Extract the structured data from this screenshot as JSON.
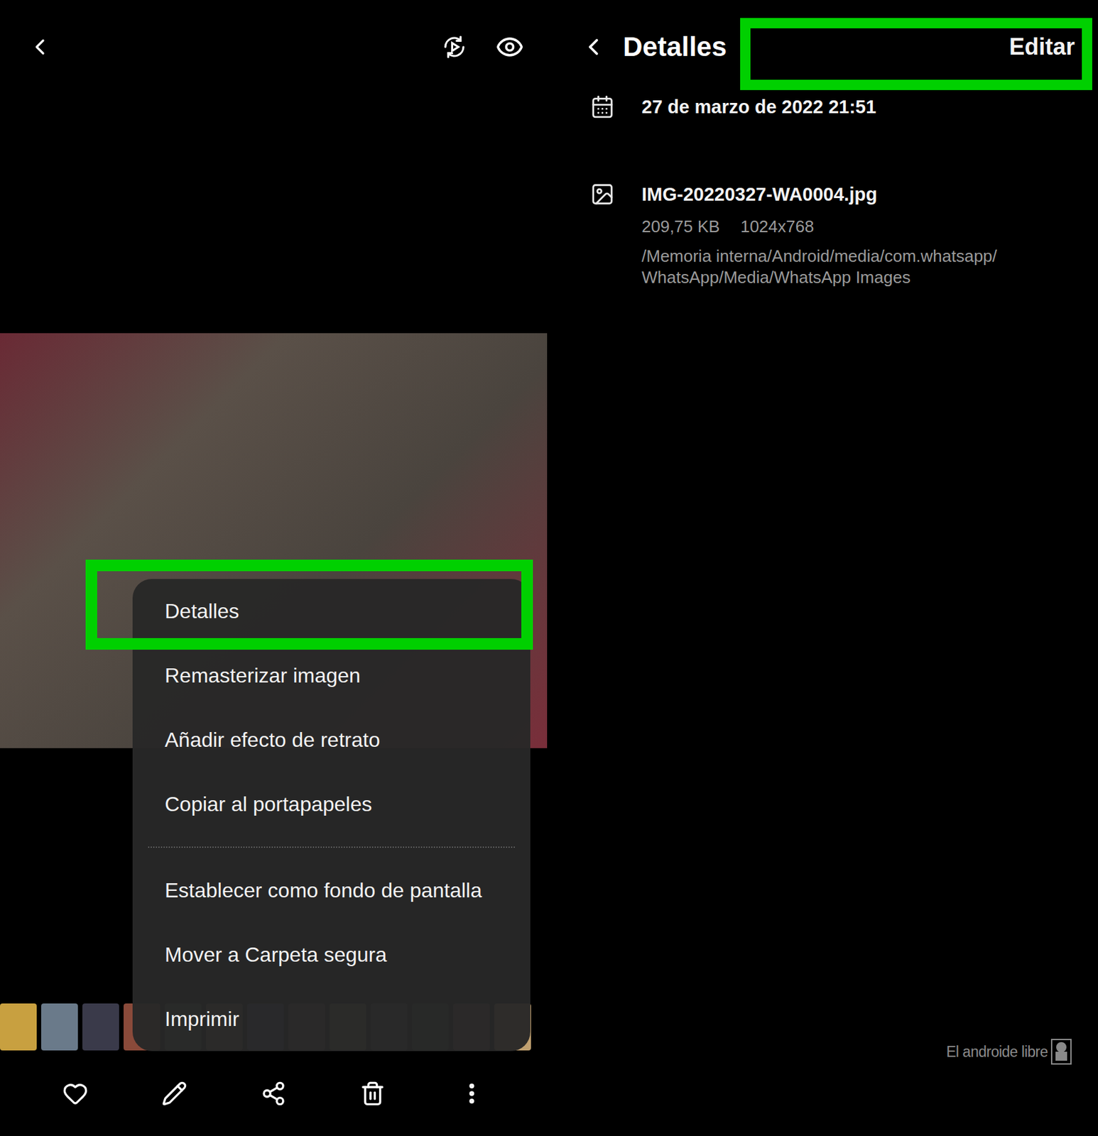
{
  "gallery": {
    "menu": {
      "items": [
        {
          "label": "Detalles",
          "highlighted": true,
          "divider_after": false
        },
        {
          "label": "Remasterizar imagen",
          "highlighted": false,
          "divider_after": false
        },
        {
          "label": "Añadir efecto de retrato",
          "highlighted": false,
          "divider_after": false
        },
        {
          "label": "Copiar al portapapeles",
          "highlighted": false,
          "divider_after": true
        },
        {
          "label": "Establecer como fondo de pantalla",
          "highlighted": false,
          "divider_after": false
        },
        {
          "label": "Mover a Carpeta segura",
          "highlighted": false,
          "divider_after": false
        },
        {
          "label": "Imprimir",
          "highlighted": false,
          "divider_after": false
        }
      ]
    }
  },
  "details": {
    "title": "Detalles",
    "edit_button": "Editar",
    "edit_highlighted": true,
    "date": "27 de marzo de 2022 21:51",
    "file_name": "IMG-20220327-WA0004.jpg",
    "size": "209,75 KB",
    "resolution": "1024x768",
    "path_lines": [
      "/Memoria interna/Android/media/com.whatsapp/",
      "WhatsApp/Media/WhatsApp Images"
    ]
  },
  "watermark": "El androide libre"
}
